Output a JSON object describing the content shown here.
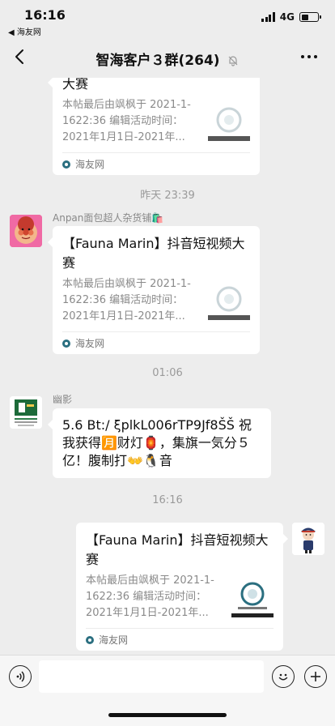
{
  "status": {
    "time": "16:16",
    "back_app": "◀ 海友网",
    "network": "4G",
    "battery_level": 0.45
  },
  "nav": {
    "title": "智海客户３群(264)"
  },
  "messages": {
    "card1": {
      "title": "大赛",
      "desc": "本帖最后由飒枫于 2021-1-1622:36 编辑活动时间：2021年1月1日-2021年...",
      "source": "海友网"
    },
    "ts1": "昨天 23:39",
    "card2": {
      "sender": "Anpan面包超人杂货铺🛍️",
      "title": "【Fauna Marin】抖音短视频大赛",
      "desc": "本帖最后由飒枫于 2021-1-1622:36 编辑活动时间：2021年1月1日-2021年...",
      "source": "海友网"
    },
    "ts2": "01:06",
    "text1": {
      "sender": "幽影",
      "text": "5.6 Bt:/ ξplkL006rTP9Jf8ŠŠ 祝我获得🈷️财灯🏮，集旗一気分５亿！腹制打👐🐧音"
    },
    "ts3": "16:16",
    "card3": {
      "title": "【Fauna Marin】抖音短视频大赛",
      "desc": "本帖最后由飒枫于 2021-1-1622:36 编辑活动时间：2021年1月1日-2021年...",
      "source": "海友网"
    }
  },
  "icons": {
    "back": "chevron-left-icon",
    "mute": "bell-mute-icon",
    "more": "more-dots-icon",
    "voice": "voice-icon",
    "emoji": "emoji-icon",
    "plus": "plus-icon",
    "site": "haiyou-logo-icon"
  },
  "colors": {
    "background": "#ededed",
    "bubble": "#ffffff",
    "timestamp": "#9a9a9a"
  }
}
